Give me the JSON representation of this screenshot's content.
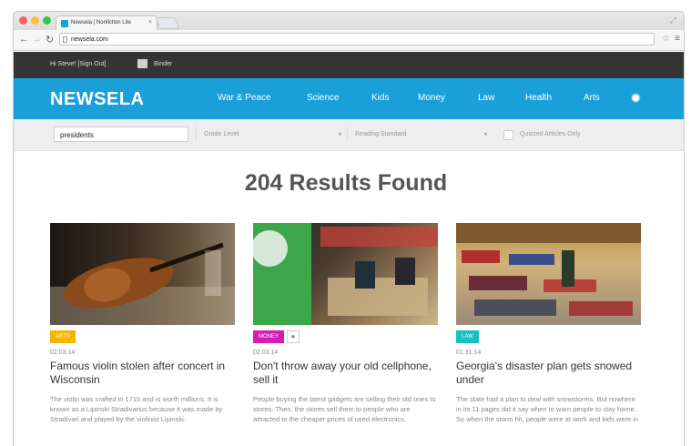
{
  "browser": {
    "tab_title": "Newsela | Nonfiction Lite",
    "tab_close": "×",
    "url": "newsela.com"
  },
  "site": {
    "greeting": "Hi Steve! [Sign Out]",
    "binder": "Binder",
    "logo": "NEWSELA",
    "nav": [
      "War & Peace",
      "Science",
      "Kids",
      "Money",
      "Law",
      "Health",
      "Arts"
    ]
  },
  "filters": {
    "search_value": "presidents",
    "grade_level": "Grade Level",
    "reading_standard": "Reading Standard",
    "quizzed": "Quizzed Articles Only"
  },
  "results_heading": "204 Results Found",
  "articles": [
    {
      "badge": "ARTS",
      "badge_color": "#f4b400",
      "date": "02.03.14",
      "title": "Famous violin stolen after concert in Wisconsin",
      "desc": "The violin was crafted in 1715 and is worth millions. It is known as a Lipinski Stradivarius because it was made by Stradivari and played by the violinist Lipinski."
    },
    {
      "badge": "MONEY",
      "badge_color": "#d81bb5",
      "date": "02.03.14",
      "title": "Don't throw away your old cellphone, sell it",
      "desc": "People buying the latest gadgets are selling their old ones to stores. Then, the stores sell them to people who are attracted to the cheaper prices of used electronics."
    },
    {
      "badge": "LAW",
      "badge_color": "#19c0c0",
      "date": "01.31.14",
      "title": "Georgia's disaster plan gets snowed under",
      "desc": "The state had a plan to deal with snowstorms. But nowhere in its 11 pages did it say when to warn people to stay home. So when the storm hit, people were at work and kids were in"
    }
  ]
}
